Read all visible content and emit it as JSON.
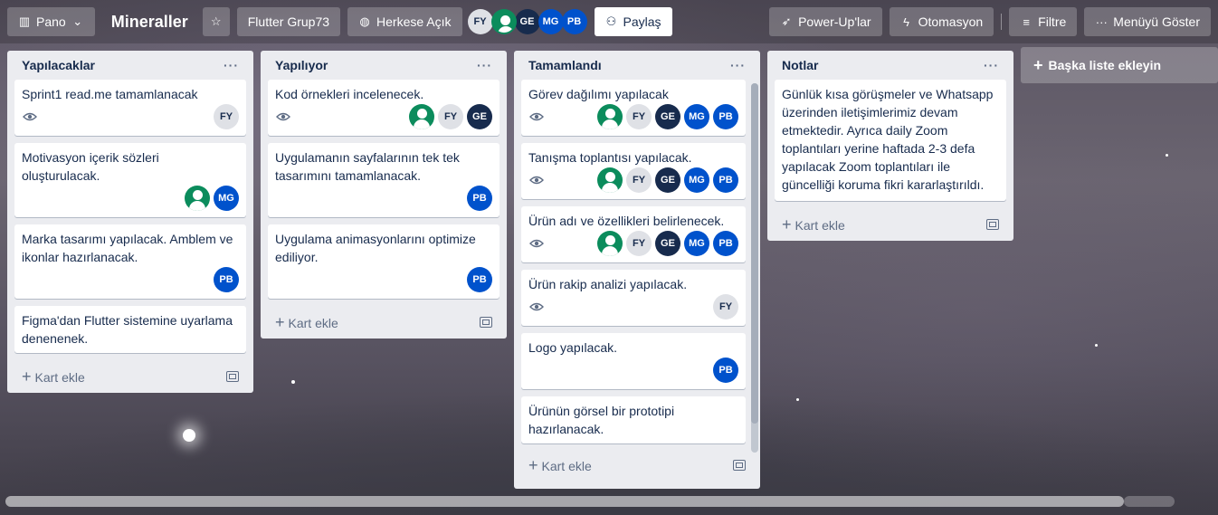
{
  "header": {
    "board_switcher": "Pano",
    "board_name": "Mineraller",
    "workspace": "Flutter Grup73",
    "visibility": "Herkese Açık",
    "members": [
      "FY",
      "GE",
      "MG",
      "PB"
    ],
    "share": "Paylaş",
    "powerups": "Power-Up'lar",
    "automation": "Otomasyon",
    "filter": "Filtre",
    "menu": "Menüyü Göster"
  },
  "lists": [
    {
      "title": "Yapılacaklar",
      "add_card": "Kart ekle",
      "cards": [
        {
          "title": "Sprint1 read.me tamamlanacak",
          "watch": true,
          "members": [
            "FY"
          ]
        },
        {
          "title": "Motivasyon içerik sözleri oluşturulacak.",
          "watch": false,
          "members": [
            "green",
            "MG"
          ]
        },
        {
          "title": "Marka tasarımı yapılacak. Amblem ve ikonlar hazırlanacak.",
          "watch": false,
          "members": [
            "PB"
          ]
        },
        {
          "title": "Figma'dan Flutter sistemine uyarlama denenenek.",
          "watch": false,
          "members": []
        }
      ]
    },
    {
      "title": "Yapılıyor",
      "add_card": "Kart ekle",
      "cards": [
        {
          "title": "Kod örnekleri incelenecek.",
          "watch": true,
          "members": [
            "green",
            "FY",
            "GE"
          ]
        },
        {
          "title": "Uygulamanın sayfalarının tek tek tasarımını tamamlanacak.",
          "watch": false,
          "members": [
            "PB"
          ]
        },
        {
          "title": "Uygulama animasyonlarını optimize ediliyor.",
          "watch": false,
          "members": [
            "PB"
          ]
        }
      ]
    },
    {
      "title": "Tamamlandı",
      "add_card": "Kart ekle",
      "cards": [
        {
          "title": "Görev dağılımı yapılacak",
          "watch": true,
          "members": [
            "green",
            "FY",
            "GE",
            "MG",
            "PB"
          ]
        },
        {
          "title": "Tanışma toplantısı yapılacak.",
          "watch": true,
          "members": [
            "green",
            "FY",
            "GE",
            "MG",
            "PB"
          ]
        },
        {
          "title": "Ürün adı ve özellikleri belirlenecek.",
          "watch": true,
          "members": [
            "green",
            "FY",
            "GE",
            "MG",
            "PB"
          ]
        },
        {
          "title": "Ürün rakip analizi yapılacak.",
          "watch": true,
          "members": [
            "FY"
          ]
        },
        {
          "title": "Logo yapılacak.",
          "watch": false,
          "members": [
            "PB"
          ]
        },
        {
          "title": "Ürünün görsel bir prototipi hazırlanacak.",
          "watch": false,
          "members": []
        }
      ]
    },
    {
      "title": "Notlar",
      "add_card": "Kart ekle",
      "cards": [
        {
          "title": "Günlük kısa görüşmeler ve Whatsapp üzerinden iletişimlerimiz devam etmektedir. Ayrıca daily Zoom toplantıları yerine haftada 2-3 defa yapılacak Zoom toplantıları ile güncelliği koruma fikri kararlaştırıldı.",
          "watch": false,
          "members": []
        }
      ]
    }
  ],
  "add_list": "Başka liste ekleyin",
  "colors": {
    "accent_blue": "#0052cc",
    "dark_navy": "#172b4d",
    "green": "#0b8c5c",
    "list_bg": "#ebecf0"
  }
}
